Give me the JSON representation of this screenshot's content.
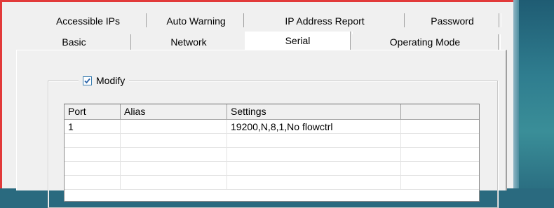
{
  "tabs": {
    "row1": [
      "Accessible IPs",
      "Auto Warning",
      "IP Address Report",
      "Password"
    ],
    "row2": [
      "Basic",
      "Network",
      "Serial",
      "Operating Mode"
    ],
    "active": "Serial"
  },
  "modify": {
    "label": "Modify",
    "checked": true
  },
  "grid": {
    "columns": [
      "Port",
      "Alias",
      "Settings",
      ""
    ],
    "rows": [
      [
        "1",
        "",
        "19200,N,8,1,No flowctrl",
        ""
      ]
    ]
  },
  "colors": {
    "window_border": "#e23a3a",
    "checkbox_accent": "#3c7fb1"
  }
}
